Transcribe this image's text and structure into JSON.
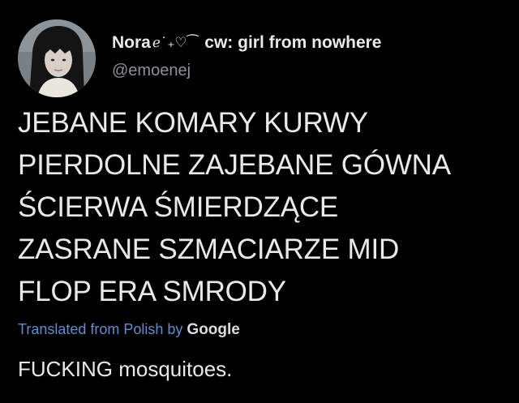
{
  "tweet": {
    "author": {
      "display_name": "Nora",
      "display_name_decoration": "ℯ˙₊♡⁀",
      "display_name_suffix": "cw: girl from nowhere",
      "handle": "@emoenej",
      "avatar_icon": "profile-photo-avatar"
    },
    "text_lines": [
      "JEBANE KOMARY KURWY",
      "PIERDOLNE ZAJEBANE GÓWNA",
      "ŚCIERWA ŚMIERDZĄCE",
      "ZASRANE SZMACIARZE MID",
      "FLOP ERA SMRODY"
    ],
    "translation": {
      "label": "Translated from Polish by",
      "provider": "Google",
      "text": "FUCKING mosquitoes."
    }
  },
  "colors": {
    "background": "#000000",
    "text": "#e7e9ea",
    "secondary_text": "#8b9196",
    "link": "#5b8fd6"
  }
}
